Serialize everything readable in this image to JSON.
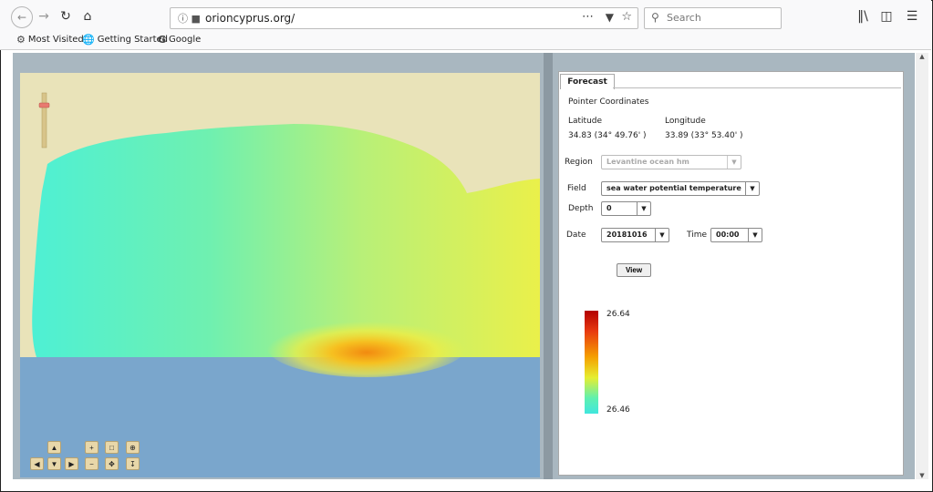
{
  "browser": {
    "url": "orioncyprus.org/",
    "search_placeholder": "Search",
    "bookmarks": [
      {
        "label": "Most Visited",
        "icon": "gear-icon"
      },
      {
        "label": "Getting Started",
        "icon": "globe-icon"
      },
      {
        "label": "Google",
        "icon": "google-icon"
      }
    ]
  },
  "panel": {
    "tab_label": "Forecast",
    "pointer_title": "Pointer Coordinates",
    "latitude_label": "Latitude",
    "latitude_value": "34.83 (34° 49.76' )",
    "longitude_label": "Longitude",
    "longitude_value": "33.89 (33° 53.40' )",
    "region_label": "Region",
    "region_value": "Levantine ocean hm",
    "field_label": "Field",
    "field_value": "sea water potential temperature",
    "depth_label": "Depth",
    "depth_value": "0",
    "date_label": "Date",
    "date_value": "20181016",
    "time_label": "Time",
    "time_value": "00:00",
    "view_label": "View",
    "legend_max": "26.64",
    "legend_min": "26.46"
  },
  "colors": {
    "land": "#e9e3b9",
    "sea": "#7aa6cc",
    "legend_high": "#b30000",
    "legend_low": "#40e6de"
  }
}
